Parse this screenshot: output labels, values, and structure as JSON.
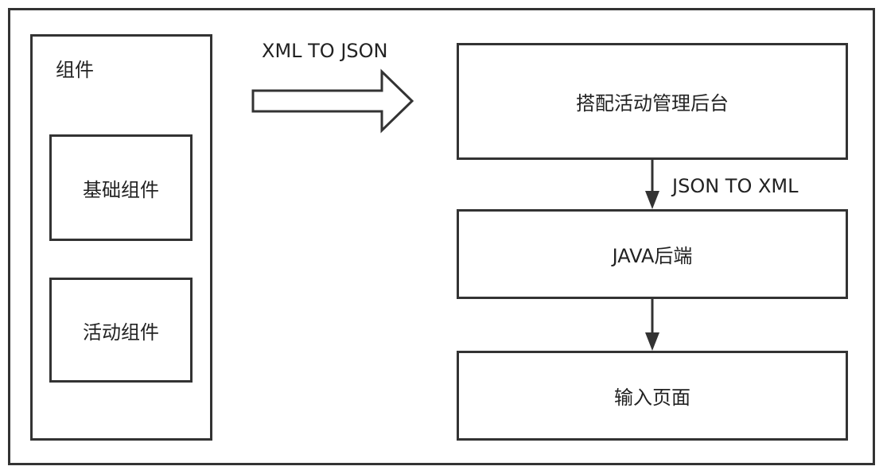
{
  "components_panel": {
    "title": "组件",
    "items": [
      {
        "label": "基础组件"
      },
      {
        "label": "活动组件"
      }
    ]
  },
  "flow": {
    "xml_to_json_label": "XML TO JSON",
    "json_to_xml_label": "JSON TO XML",
    "nodes": [
      {
        "label": "搭配活动管理后台"
      },
      {
        "label": "JAVA后端"
      },
      {
        "label": "输入页面"
      }
    ]
  },
  "colors": {
    "stroke": "#333333",
    "background": "#ffffff",
    "text": "#222222"
  }
}
